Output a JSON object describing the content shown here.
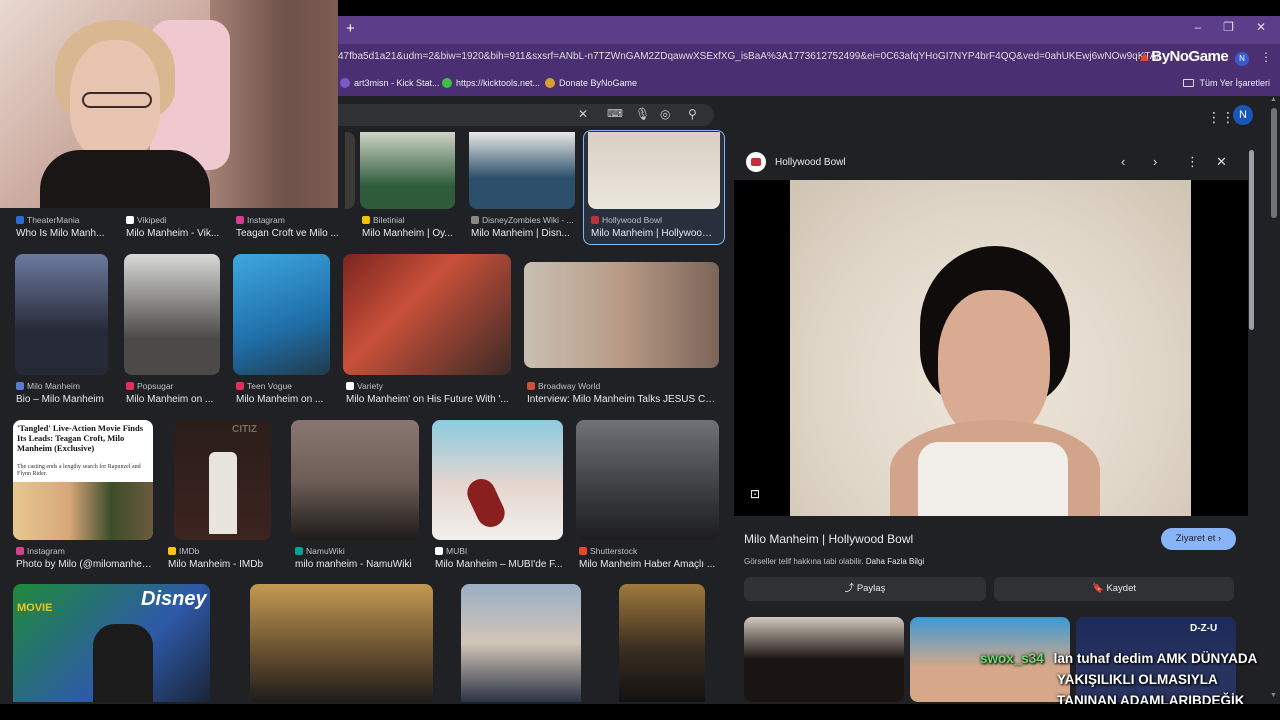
{
  "browser": {
    "url": "47fba5d1a21&udm=2&biw=1920&bih=911&sxsrf=ANbL-n7TZWnGAM2ZDqawwXSExfXG_isBaA%3A1773612752499&ei=0C63afqYHoGI7NYP4brF4QQ&ved=0ahUKEwj6wNOw9qKTAxUBBNsEHW",
    "brand": "ByNoGame",
    "profile_initial": "N",
    "bookmarks": [
      "art3misn - Kick Stat...",
      "https://kicktools.net...",
      "Donate ByNoGame"
    ],
    "all_bookmarks": "Tüm Yer İşaretleri"
  },
  "header": {
    "user_initial": "N"
  },
  "results": [
    {
      "source": "TheaterMania",
      "title": "Who Is Milo Manh...",
      "fav": "#2b6cd6"
    },
    {
      "source": "Vikipedi",
      "title": "Milo Manheim - Vik...",
      "fav": "#ffffff"
    },
    {
      "source": "Instagram",
      "title": "Teagan Croft ve Milo ...",
      "fav": "#d63e8e"
    },
    {
      "source": "Biletinial",
      "title": "Milo Manheim | Oy...",
      "fav": "#f2c200"
    },
    {
      "source": "DisneyZombies Wiki - ...",
      "title": "Milo Manheim | Disn...",
      "fav": "#888888"
    },
    {
      "source": "Hollywood Bowl",
      "title": "Milo Manheim | Hollywood ...",
      "fav": "#c0303b"
    },
    {
      "source": "Milo Manheim",
      "title": "Bio – Milo Manheim",
      "fav": "#5a7ad6"
    },
    {
      "source": "Popsugar",
      "title": "Milo Manheim on ...",
      "fav": "#e0305a"
    },
    {
      "source": "Teen Vogue",
      "title": "Milo Manheim on ...",
      "fav": "#e0305a"
    },
    {
      "source": "Variety",
      "title": "Milo Manheim' on His Future With '...",
      "fav": "#ffffff"
    },
    {
      "source": "Broadway World",
      "title": "Interview: Milo Manheim Talks JESUS CH...",
      "fav": "#d0503a"
    },
    {
      "source": "Instagram",
      "title": "Photo by Milo (@milomanhei...",
      "fav": "#d63e8e"
    },
    {
      "source": "IMDb",
      "title": "Milo Manheim - IMDb",
      "fav": "#f5c518"
    },
    {
      "source": "NamuWiki",
      "title": "milo manheim - NamuWiki",
      "fav": "#00a495"
    },
    {
      "source": "MUBI",
      "title": "Milo Manheim – MUBI'de F...",
      "fav": "#ffffff"
    },
    {
      "source": "Shutterstock",
      "title": "Milo Manheim Haber Amaçlı ...",
      "fav": "#e8452c"
    }
  ],
  "article_thumb": {
    "headline": "'Tangled' Live-Action Movie Finds Its Leads: Teagan Croft, Milo Manheim (Exclusive)",
    "sub": "The casting ends a lengthy search for Rapunzel and Flynn Rider."
  },
  "thumb_texts": {
    "disney": "Disney",
    "movie": "MOVIE",
    "citizen": "CITIZ"
  },
  "panel": {
    "site": "Hollywood Bowl",
    "title": "Milo Manheim | Hollywood Bowl",
    "visit": "Ziyaret et",
    "copyright": "Görseller telif hakkına tabi olabilir.",
    "more_info": "Daha Fazla Bilgi",
    "share": "Paylaş",
    "save": "Kaydet",
    "related_text": "D-Z-U"
  },
  "chat": {
    "user": "swox_s34",
    "line1": "lan tuhaf dedim AMK DÜNYADA",
    "line2": "YAKIŞILIKLI OLMASIYLA",
    "line3": "TANINAN ADAMLARIBDEĞİK"
  }
}
